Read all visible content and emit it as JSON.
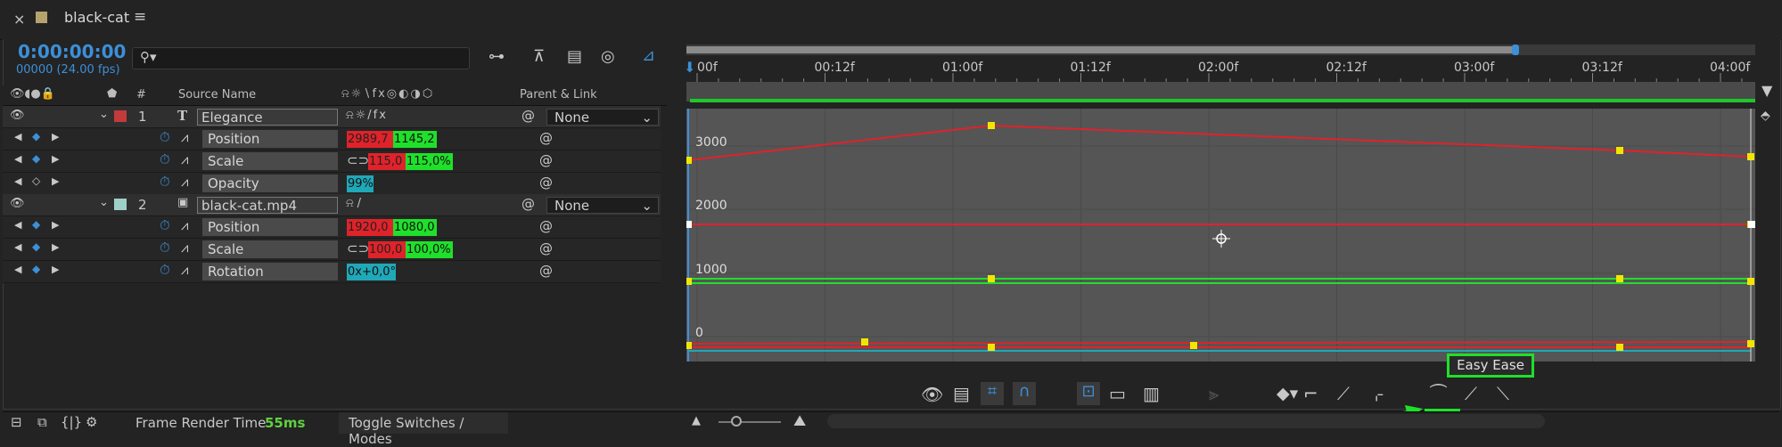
{
  "tab": {
    "title": "black-cat"
  },
  "timecode": {
    "value": "0:00:00:00",
    "fps": "00000 (24.00 fps)"
  },
  "columns": {
    "hash": "#",
    "source": "Source Name",
    "parent": "Parent & Link"
  },
  "layers": [
    {
      "index": "1",
      "name": "Elegance",
      "parent": "None",
      "color": "#c33a3a",
      "props": [
        {
          "name": "Position",
          "values": [
            "2989,7",
            "1145,2"
          ]
        },
        {
          "name": "Scale",
          "values": [
            "115,0",
            "115,0%"
          ]
        },
        {
          "name": "Opacity",
          "values": [
            "99%"
          ]
        }
      ]
    },
    {
      "index": "2",
      "name": "black-cat.mp4",
      "parent": "None",
      "color": "#9fd0c8",
      "props": [
        {
          "name": "Position",
          "values": [
            "1920,0",
            "1080,0"
          ]
        },
        {
          "name": "Scale",
          "values": [
            "100,0",
            "100,0%"
          ]
        },
        {
          "name": "Rotation",
          "values": [
            "0x+0,0°"
          ]
        }
      ]
    }
  ],
  "ruler": {
    "ticks": [
      "00f",
      "00:12f",
      "01:00f",
      "01:12f",
      "02:00f",
      "02:12f",
      "03:00f",
      "03:12f",
      "04:00f"
    ]
  },
  "graph": {
    "y_labels": [
      "3000",
      "2000",
      "1000",
      "0"
    ]
  },
  "tooltip": {
    "label": "Easy Ease"
  },
  "bottom": {
    "frame_render_label": "Frame Render Time",
    "frame_render_value": "55ms",
    "toggle": "Toggle Switches / Modes"
  },
  "colors": {
    "accent": "#3d8fd8",
    "red": "#e0222a",
    "green": "#1fe02a",
    "highlight": "#1ee02a"
  }
}
